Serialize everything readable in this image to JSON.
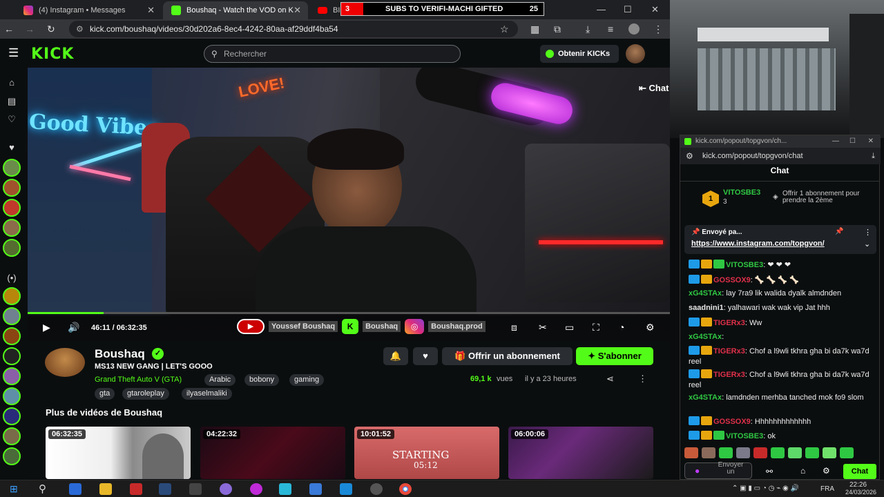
{
  "browser": {
    "tabs": [
      {
        "label": "(4) Instagram • Messages"
      },
      {
        "label": "Boushaq - Watch the VOD on K"
      },
      {
        "label": "BIG... - Yo"
      }
    ],
    "url": "kick.com/boushaq/videos/30d202a6-8ec4-4242-80aa-af29ddf4ba54"
  },
  "overlay": {
    "sub_text": "SUBS TO VERIFI-MACHI GIFTED",
    "sub_count": "25"
  },
  "kick": {
    "logo": "KICK",
    "search_placeholder": "Rechercher",
    "get_kicks": "Obtenir KICKs",
    "chat_toggle": "Chat"
  },
  "player": {
    "time": "46:11 / 06:32:35",
    "progress": 0.118,
    "socials": [
      "Youssef Boushaq",
      "Boushaq",
      "Boushaq.prod"
    ]
  },
  "video_scene": {
    "sign_good": "Good Vibes",
    "sign_love": "LOVE!"
  },
  "channel": {
    "name": "Boushaq",
    "title": "MS13 NEW GANG | LET'S GOOO",
    "category": "Grand Theft Auto V (GTA)",
    "tags": [
      "Arabic",
      "bobony",
      "gaming",
      "gta",
      "gtaroleplay",
      "ilyaselmaliki"
    ],
    "views": "69,1 k",
    "views_suffix": "vues",
    "ago": "il y a 23 heures",
    "gift_label": "Offrir un abonnement",
    "sub_label": "S'abonner",
    "more_title": "Plus de vidéos de Boushaq"
  },
  "more_videos": [
    {
      "duration": "06:32:35"
    },
    {
      "duration": "04:22:32"
    },
    {
      "duration": "10:01:52",
      "overlay": "STARTING",
      "overlay_time": "05:12"
    },
    {
      "duration": "06:00:06"
    }
  ],
  "popout": {
    "bar_title": "kick.com/popout/topgvon/ch...",
    "url": "kick.com/popout/topgvon/chat",
    "header": "Chat",
    "sub_user": "VITOSBE3",
    "sub_count": "3",
    "sub_offer": "Offrir 1 abonnement pour prendre la 2ème",
    "pinned_label": "Envoyé pa...",
    "pinned_link": "https://www.instagram.com/topgvon/",
    "send_label": "Envoyer un",
    "chat_button": "Chat"
  },
  "chat": [
    {
      "user": "VITOSBE3",
      "text": "❤ ❤ ❤",
      "color": "#2fc843",
      "badges": [
        "a",
        "b",
        "g"
      ]
    },
    {
      "user": "GOSSOX9",
      "text": "🦴 🦴 🦴 🦴",
      "color": "#e0304a",
      "badges": [
        "a",
        "b"
      ]
    },
    {
      "user": "xG4STAx",
      "text": "lay 7ra9 lik walida dyalk almdnden",
      "color": "#2fc843",
      "badges": []
    },
    {
      "user": "saadnini1",
      "text": "yalhawari wak wak vip Jat hhh",
      "color": "#e8e8e8",
      "badges": []
    },
    {
      "user": "TIGERx3",
      "text": "Ww",
      "color": "#e0304a",
      "badges": [
        "a",
        "b"
      ]
    },
    {
      "user": "xG4STAx",
      "text": "",
      "color": "#2fc843",
      "badges": []
    },
    {
      "user": "TIGERx3",
      "text": "Chof a l9wli tkhra gha bi da7k wa7d reel",
      "color": "#e0304a",
      "badges": [
        "a",
        "b"
      ]
    },
    {
      "user": "TIGERx3",
      "text": "Chof a l9wli tkhra gha bi da7k wa7d reel",
      "color": "#e0304a",
      "badges": [
        "a",
        "b"
      ]
    },
    {
      "user": "xG4STAx",
      "text": "lamdnden merhba tanched mok fo9 slom",
      "color": "#2fc843",
      "badges": []
    },
    {
      "user": "GOSSOX9",
      "text": "Hhhhhhhhhhhhh",
      "color": "#e0304a",
      "badges": [
        "a",
        "b"
      ]
    },
    {
      "user": "VITOSBE3",
      "text": "ok",
      "color": "#2fc843",
      "badges": [
        "a",
        "b",
        "g"
      ]
    }
  ],
  "taskbar": {
    "lang": "FRA",
    "time": "22:26",
    "date": "24/03/2026"
  }
}
